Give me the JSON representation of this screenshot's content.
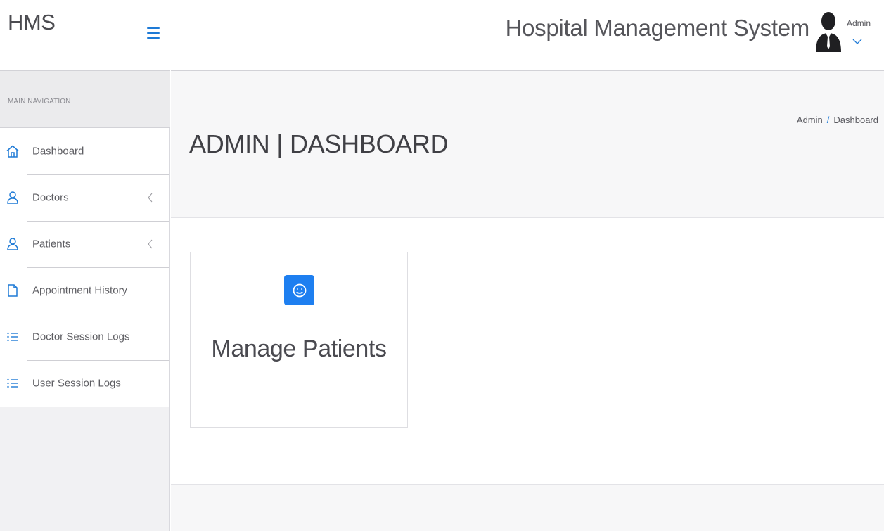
{
  "brand": {
    "name": "HMS"
  },
  "sidebar": {
    "section_header": "MAIN NAVIGATION",
    "items": [
      {
        "label": "Dashboard",
        "icon": "home-icon",
        "has_submenu": false
      },
      {
        "label": "Doctors",
        "icon": "user-icon",
        "has_submenu": true
      },
      {
        "label": "Patients",
        "icon": "user-icon",
        "has_submenu": true
      },
      {
        "label": "Appointment History",
        "icon": "file-icon",
        "has_submenu": false
      },
      {
        "label": "Doctor Session Logs",
        "icon": "list-icon",
        "has_submenu": false
      },
      {
        "label": "User Session Logs",
        "icon": "list-icon",
        "has_submenu": false
      }
    ]
  },
  "header": {
    "system_title": "Hospital Management System",
    "user_name": "Admin"
  },
  "page": {
    "title": "ADMIN | DASHBOARD",
    "breadcrumb": [
      "Admin",
      "Dashboard"
    ],
    "breadcrumb_separator": "/"
  },
  "cards": [
    {
      "title": "Manage Patients",
      "icon": "smile-icon"
    }
  ],
  "colors": {
    "accent": "#1e7ad6",
    "card_icon_bg": "#1e7ff0",
    "sidebar_bg": "#f1f1f3",
    "title_band_bg": "#f7f7f8"
  }
}
